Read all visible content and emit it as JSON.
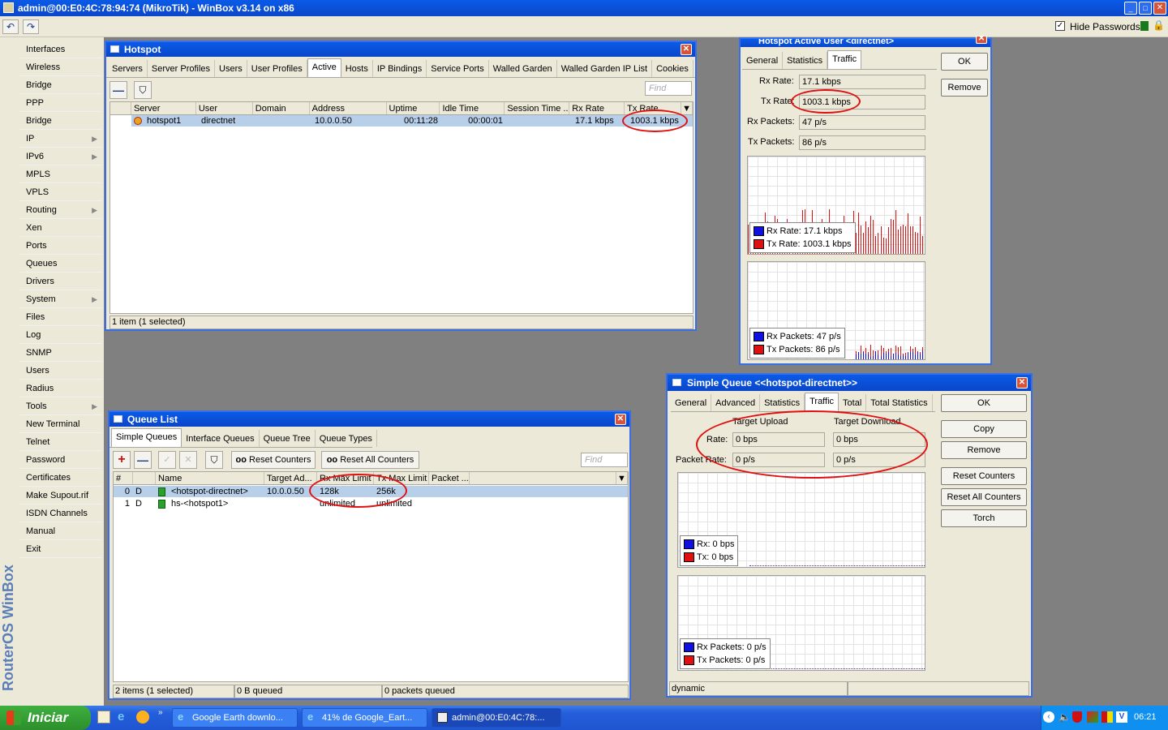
{
  "window_title": "admin@00:E0:4C:78:94:74 (MikroTik) - WinBox v3.14 on x86",
  "toolbar": {
    "hide_passwords_label": "Hide Passwords"
  },
  "brand": "RouterOS WinBox",
  "sidebar": [
    "Interfaces",
    "Wireless",
    "Bridge",
    "PPP",
    "Bridge",
    "IP",
    "IPv6",
    "MPLS",
    "VPLS",
    "Routing",
    "Xen",
    "Ports",
    "Queues",
    "Drivers",
    "System",
    "Files",
    "Log",
    "SNMP",
    "Users",
    "Radius",
    "Tools",
    "New Terminal",
    "Telnet",
    "Password",
    "Certificates",
    "Make Supout.rif",
    "ISDN Channels",
    "Manual",
    "Exit"
  ],
  "hotspot": {
    "title": "Hotspot",
    "tabs": [
      "Servers",
      "Server Profiles",
      "Users",
      "User Profiles",
      "Active",
      "Hosts",
      "IP Bindings",
      "Service Ports",
      "Walled Garden",
      "Walled Garden IP List",
      "Cookies"
    ],
    "find": "Find",
    "columns": [
      "Server",
      "User",
      "Domain",
      "Address",
      "Uptime",
      "Idle Time",
      "Session Time ...",
      "Rx Rate",
      "Tx Rate"
    ],
    "row": {
      "server": "hotspot1",
      "user": "directnet",
      "domain": "",
      "address": "10.0.0.50",
      "uptime": "00:11:28",
      "idle": "00:00:01",
      "session": "",
      "rx": "17.1 kbps",
      "tx": "1003.1 kbps"
    },
    "status": "1 item (1 selected)"
  },
  "active_user": {
    "title": "Hotspot Active User <directnet>",
    "tabs": [
      "General",
      "Statistics",
      "Traffic"
    ],
    "ok": "OK",
    "remove": "Remove",
    "rx_rate_label": "Rx Rate:",
    "rx_rate": "17.1 kbps",
    "tx_rate_label": "Tx Rate:",
    "tx_rate": "1003.1 kbps",
    "rx_packets_label": "Rx Packets:",
    "rx_packets": "47 p/s",
    "tx_packets_label": "Tx Packets:",
    "tx_packets": "86 p/s",
    "legend1": {
      "rx": "Rx Rate:  17.1 kbps",
      "tx": "Tx Rate:  1003.1 kbps"
    },
    "legend2": {
      "rx": "Rx Packets:  47 p/s",
      "tx": "Tx Packets:  86 p/s"
    }
  },
  "queue_list": {
    "title": "Queue List",
    "tabs": [
      "Simple Queues",
      "Interface Queues",
      "Queue Tree",
      "Queue Types"
    ],
    "reset_counters": "Reset Counters",
    "reset_all_counters": "Reset All Counters",
    "find": "Find",
    "columns": [
      "#",
      "Name",
      "Target Ad...",
      "Rx Max Limit",
      "Tx Max Limit",
      "Packet ..."
    ],
    "rows": [
      {
        "num": "0",
        "flag": "D",
        "name": "<hotspot-directnet>",
        "target": "10.0.0.50",
        "rx": "128k",
        "tx": "256k"
      },
      {
        "num": "1",
        "flag": "D",
        "name": "hs-<hotspot1>",
        "target": "",
        "rx": "unlimited",
        "tx": "unlimited"
      }
    ],
    "status": [
      "2 items (1 selected)",
      "0 B queued",
      "0 packets queued"
    ]
  },
  "simple_queue": {
    "title": "Simple Queue <<hotspot-directnet>>",
    "tabs": [
      "General",
      "Advanced",
      "Statistics",
      "Traffic",
      "Total",
      "Total Statistics"
    ],
    "target_upload": "Target Upload",
    "target_download": "Target Download",
    "rate_label": "Rate:",
    "rate_up": "0 bps",
    "rate_down": "0 bps",
    "packet_rate_label": "Packet Rate:",
    "pkt_up": "0 p/s",
    "pkt_down": "0 p/s",
    "legend1": {
      "rx": "Rx:  0 bps",
      "tx": "Tx:  0 bps"
    },
    "legend2": {
      "rx": "Rx Packets:  0 p/s",
      "tx": "Tx Packets:  0 p/s"
    },
    "buttons": [
      "OK",
      "Copy",
      "Remove",
      "Reset Counters",
      "Reset All Counters",
      "Torch"
    ],
    "status": "dynamic"
  },
  "taskbar": {
    "start": "Iniciar",
    "tasks": [
      "Google Earth downlo...",
      "41% de Google_Eart...",
      "admin@00:E0:4C:78:..."
    ],
    "clock": "06:21"
  },
  "colors": {
    "rx": "#1010e0",
    "tx": "#e01010",
    "accent": "#0a5be8"
  }
}
